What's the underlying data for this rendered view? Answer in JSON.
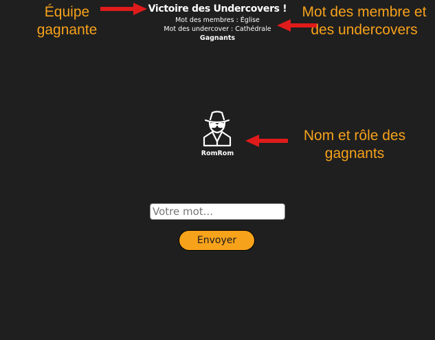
{
  "game": {
    "result_title": "Victoire des Undercovers !",
    "members_word_line": "Mot des membres : Église",
    "undercover_word_line": "Mot des undercover : Cathédrale",
    "winners_heading": "Gagnants",
    "winner": {
      "name": "RomRom",
      "icon": "spy-icon"
    }
  },
  "form": {
    "word_input_placeholder": "Votre mot...",
    "word_input_value": "",
    "send_label": "Envoyer"
  },
  "annotations": {
    "team_note": "Équipe gagnante",
    "words_note": "Mot des membre et des undercovers",
    "winners_note": "Nom et rôle des gagnants",
    "arrow_icon": "red-arrow-icon"
  },
  "colors": {
    "background": "#1f1f1f",
    "accent": "#f7a21b",
    "arrow": "#e01b1b",
    "text": "#ffffff"
  }
}
